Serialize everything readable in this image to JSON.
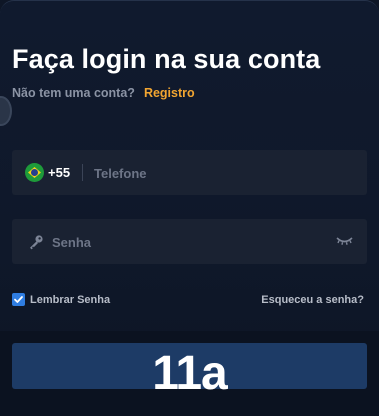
{
  "login": {
    "title": "Faça login na sua conta",
    "no_account_text": "Não tem uma conta?",
    "register_link": "Registro"
  },
  "phone": {
    "country_flag": "brazil-flag-icon",
    "dial_code": "+55",
    "value": "",
    "placeholder": "Telefone"
  },
  "password": {
    "value": "",
    "placeholder": "Senha",
    "leading_icon": "key-icon",
    "toggle_icon": "eye-closed-icon"
  },
  "options": {
    "remember_label": "Lembrar Senha",
    "remember_checked": true,
    "forgot_link": "Esqueceu a senha?"
  },
  "submit": {
    "label": "11a"
  },
  "colors": {
    "background": "#0f182a",
    "field": "#1a2232",
    "accent_link": "#f2a531",
    "checkbox": "#2f7de1",
    "button": "#1d3b66"
  }
}
